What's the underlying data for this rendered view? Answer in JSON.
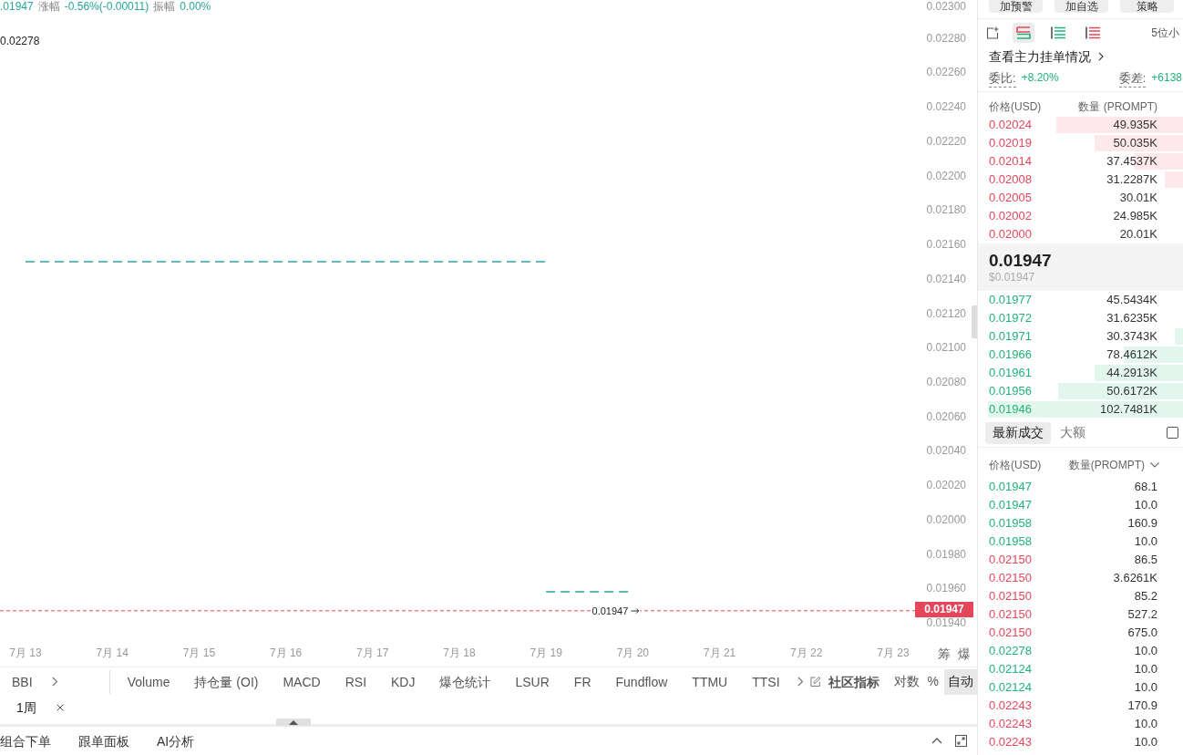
{
  "chart": {
    "header": {
      "close": ".01947",
      "stats": [
        {
          "label": "涨幅",
          "value": "-0.56%(-0.00011)"
        },
        {
          "label": "振幅",
          "value": "0.00%"
        }
      ]
    },
    "chart_data": {
      "type": "line",
      "categories": [
        "7月 13",
        "7月 14",
        "7月 15",
        "7月 16",
        "7月 17",
        "7月 18",
        "7月 19",
        "7月 20",
        "7月 21",
        "7月 22",
        "7月 23"
      ],
      "ylim": [
        0.0194,
        0.023
      ],
      "yticks": [
        {
          "value": 0.023,
          "label": "0.02300"
        },
        {
          "value": 0.0228,
          "label": "0.02280"
        },
        {
          "value": 0.0226,
          "label": "0.02260"
        },
        {
          "value": 0.0224,
          "label": "0.02240"
        },
        {
          "value": 0.0222,
          "label": "0.02220"
        },
        {
          "value": 0.022,
          "label": "0.02200"
        },
        {
          "value": 0.0218,
          "label": "0.02180"
        },
        {
          "value": 0.0216,
          "label": "0.02160"
        },
        {
          "value": 0.0214,
          "label": "0.02140"
        },
        {
          "value": 0.0212,
          "label": "0.02120"
        },
        {
          "value": 0.021,
          "label": "0.02100"
        },
        {
          "value": 0.0208,
          "label": "0.02080"
        },
        {
          "value": 0.0206,
          "label": "0.02060"
        },
        {
          "value": 0.0204,
          "label": "0.02040"
        },
        {
          "value": 0.0202,
          "label": "0.02020"
        },
        {
          "value": 0.02,
          "label": "0.02000"
        },
        {
          "value": 0.0198,
          "label": "0.01980"
        },
        {
          "value": 0.0196,
          "label": "0.01960"
        },
        {
          "value": 0.0194,
          "label": "0.01940"
        }
      ],
      "series": [
        {
          "color": "#26a69a",
          "line_style": "dashed",
          "values": [
            0.0215,
            0.0215,
            0.0215,
            0.0215,
            0.0215,
            0.0215,
            0.0215,
            null,
            null,
            null,
            null
          ]
        },
        {
          "color": "#26a69a",
          "line_style": "dashed",
          "values": [
            null,
            null,
            null,
            null,
            null,
            null,
            0.01958,
            0.01958,
            null,
            null,
            null
          ]
        }
      ],
      "ref_lines": [
        {
          "axis": "y",
          "value": 0.01947,
          "label": "0.01947",
          "color": "#e5465a"
        }
      ],
      "annotations": [
        "0.02278"
      ]
    },
    "price_tag": "0.01947",
    "axis_buttons": [
      "筹",
      "爆"
    ]
  },
  "indicator_bar": {
    "main_indicators": [
      "BBI"
    ],
    "sub_indicators": [
      "Volume",
      "持仓量 (OI)",
      "MACD",
      "RSI",
      "KDJ",
      "爆仓统计",
      "LSUR",
      "FR",
      "Fundflow",
      "TTMU",
      "TTSI"
    ],
    "community_button": "社区指标",
    "scale_options": [
      {
        "label": "对数",
        "selected": false
      },
      {
        "label": "%",
        "selected": false
      },
      {
        "label": "自动",
        "selected": true
      }
    ]
  },
  "timeframe_tabs": [
    "1周"
  ],
  "bottom_tabs": [
    "组合下单",
    "跟单面板",
    "AI分析"
  ],
  "order_book": {
    "top_buttons": [
      "加预警",
      "加自选",
      "策略"
    ],
    "depth_views": [
      {
        "kind": "both",
        "selected": true
      },
      {
        "kind": "bids",
        "selected": false
      },
      {
        "kind": "asks",
        "selected": false
      }
    ],
    "precision": "5位小",
    "whale_link": "查看主力挂单情况",
    "ratio": {
      "label": "委比:",
      "value": "+8.20%"
    },
    "diff": {
      "label": "委差:",
      "value": "+6138"
    },
    "columns": [
      "价格(USD)",
      "数量 (PROMPT)"
    ],
    "asks": [
      {
        "price": "0.02024",
        "amount": "49.935K",
        "level": 0.62
      },
      {
        "price": "0.02019",
        "amount": "50.035K",
        "level": 0.43
      },
      {
        "price": "0.02014",
        "amount": "37.4537K",
        "level": 0.24
      },
      {
        "price": "0.02008",
        "amount": "31.2287K",
        "level": 0.09
      },
      {
        "price": "0.02005",
        "amount": "30.01K"
      },
      {
        "price": "0.02002",
        "amount": "24.985K"
      },
      {
        "price": "0.02000",
        "amount": "20.01K"
      }
    ],
    "last_price": "0.01947",
    "last_price_usd": "$0.01947",
    "bids": [
      {
        "price": "0.01977",
        "amount": "45.5434K"
      },
      {
        "price": "0.01972",
        "amount": "31.6235K"
      },
      {
        "price": "0.01971",
        "amount": "30.3743K",
        "level": 0.04
      },
      {
        "price": "0.01966",
        "amount": "78.4612K",
        "level": 0.29
      },
      {
        "price": "0.01961",
        "amount": "44.2913K",
        "level": 0.43
      },
      {
        "price": "0.01956",
        "amount": "50.6172K",
        "level": 0.61
      },
      {
        "price": "0.01946",
        "amount": "102.7481K",
        "level": 0.95
      }
    ]
  },
  "trades": {
    "tabs": [
      {
        "label": "最新成交",
        "selected": true
      },
      {
        "label": "大额",
        "selected": false
      }
    ],
    "filter_checkbox": {
      "checked": false
    },
    "columns": [
      "价格(USD)",
      "数量(PROMPT)"
    ],
    "rows": [
      {
        "price": "0.01947",
        "amount": "68.1",
        "color": "#20b27a"
      },
      {
        "price": "0.01947",
        "amount": "10.0",
        "color": "#20b27a"
      },
      {
        "price": "0.01958",
        "amount": "160.9",
        "color": "#20b27a"
      },
      {
        "price": "0.01958",
        "amount": "10.0",
        "color": "#20b27a"
      },
      {
        "price": "0.02150",
        "amount": "86.5",
        "color": "#e5465a"
      },
      {
        "price": "0.02150",
        "amount": "3.6261K",
        "color": "#e5465a"
      },
      {
        "price": "0.02150",
        "amount": "85.2",
        "color": "#e5465a"
      },
      {
        "price": "0.02150",
        "amount": "527.2",
        "color": "#e5465a"
      },
      {
        "price": "0.02150",
        "amount": "675.0",
        "color": "#e5465a"
      },
      {
        "price": "0.02278",
        "amount": "10.0",
        "color": "#20b27a"
      },
      {
        "price": "0.02124",
        "amount": "10.0",
        "color": "#20b27a"
      },
      {
        "price": "0.02124",
        "amount": "10.0",
        "color": "#20b27a"
      },
      {
        "price": "0.02243",
        "amount": "170.9",
        "color": "#e5465a"
      },
      {
        "price": "0.02243",
        "amount": "10.0",
        "color": "#e5465a"
      },
      {
        "price": "0.02243",
        "amount": "10.0",
        "color": "#e5465a"
      }
    ]
  }
}
